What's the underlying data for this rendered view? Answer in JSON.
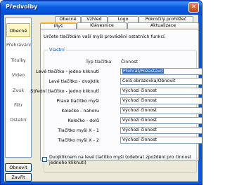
{
  "window": {
    "title": "Předvolby",
    "close_glyph": "✕"
  },
  "sidebar": {
    "items": [
      {
        "label": "Obecné"
      },
      {
        "label": "Přehrávání"
      },
      {
        "label": "Titulky"
      },
      {
        "label": "Video"
      },
      {
        "label": "Zvuk"
      },
      {
        "label": "Filtr"
      },
      {
        "label": "Ostatní"
      }
    ],
    "buttons": {
      "reset": "Obnovit",
      "close": "Zavřít"
    }
  },
  "tabs": {
    "row1": [
      "Obecné",
      "Vzhled",
      "Logo",
      "Pokročilý prohlížeč"
    ],
    "row2": [
      "Myš",
      "Klávesnice",
      "Aktualizace"
    ]
  },
  "panel": {
    "description": "Určete tlačítkám vaší myši provádění ostatních funkcí.",
    "group_title": "Vlastní",
    "col_type": "Typ tlačítka",
    "col_action": "Činnost",
    "rows": [
      {
        "label": "Levé tlačítko - jedno kliknutí",
        "value": "Přehrát/Pozastavit"
      },
      {
        "label": "Levé tlačítko - dvojklik",
        "value": "Celá obrazovka/Obnovit"
      },
      {
        "label": "Střední tlačítko - jedno kliknutí",
        "value": "Výchozí činnost"
      },
      {
        "label": "Pravé tlačítko myši",
        "value": "Výchozí činnost"
      },
      {
        "label": "Kolečko - nahoru",
        "value": "Výchozí činnost"
      },
      {
        "label": "Kolečko - dolů",
        "value": "Výchozí činnost"
      },
      {
        "label": "Tlačítko myši X - 1",
        "value": "Výchozí činnost"
      },
      {
        "label": "Tlačítko myši X - 2",
        "value": "Výchozí činnost"
      }
    ],
    "checkbox_label": "Dvojkliknem na levé tlačítko myši (odebrat zpoždění pro činnost jednoho kliknutí)"
  }
}
